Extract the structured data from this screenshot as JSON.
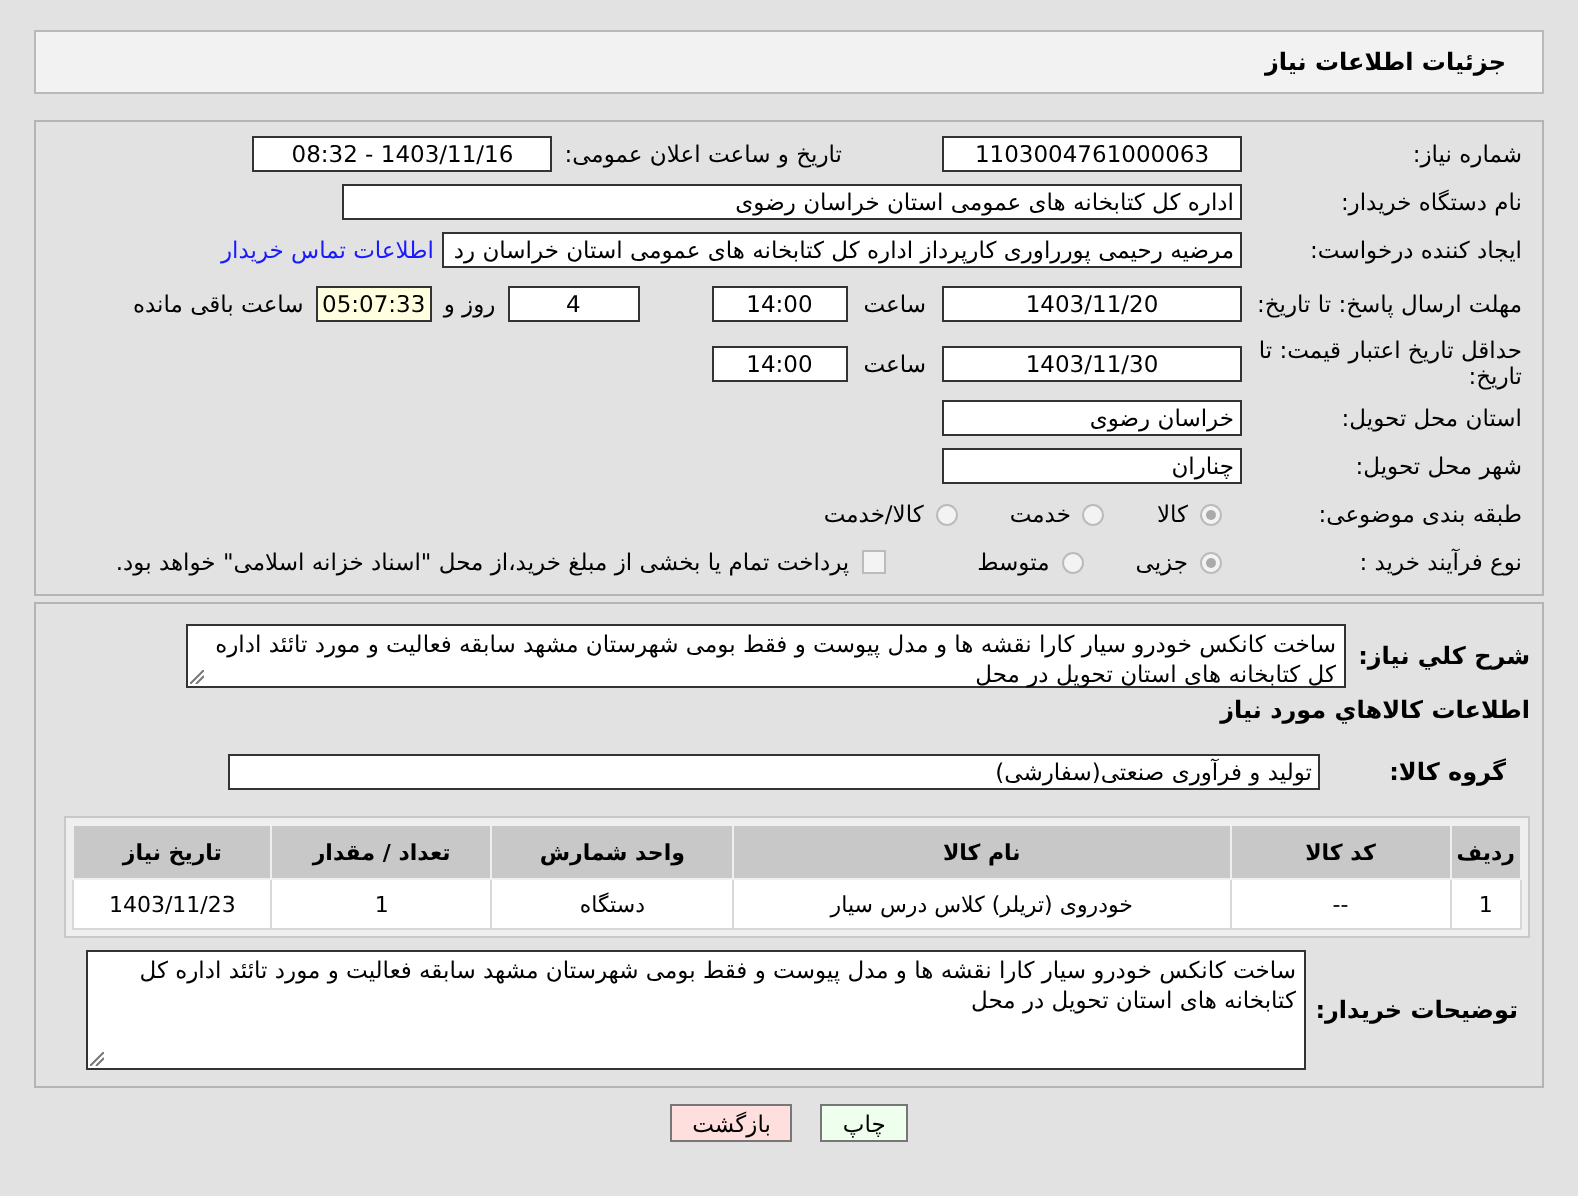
{
  "header": {
    "title": "جزئیات اطلاعات نیاز"
  },
  "need_number": {
    "label": "شماره نیاز:",
    "value": "1103004761000063"
  },
  "announce": {
    "label": "تاریخ و ساعت اعلان عمومی:",
    "value": "1403/11/16 - 08:32"
  },
  "buyer_org": {
    "label": "نام دستگاه خریدار:",
    "value": "اداره کل کتابخانه های عمومی استان خراسان رضوی"
  },
  "requester": {
    "label": "ایجاد کننده درخواست:",
    "value": "مرضیه رحیمی پورراوری کارپرداز اداره کل کتابخانه های عمومی استان خراسان رد",
    "link": "اطلاعات تماس خریدار"
  },
  "reply_deadline": {
    "label": "مهلت ارسال پاسخ: تا تاریخ:",
    "date": "1403/11/20",
    "time_label": "ساعت",
    "time": "14:00",
    "days": "4",
    "days_label": "روز و",
    "remaining": "05:07:33",
    "remaining_label": "ساعت باقی مانده"
  },
  "price_validity": {
    "label": "حداقل تاریخ اعتبار قیمت: تا تاریخ:",
    "date": "1403/11/30",
    "time_label": "ساعت",
    "time": "14:00"
  },
  "province": {
    "label": "استان محل تحویل:",
    "value": "خراسان رضوی"
  },
  "city": {
    "label": "شهر محل تحویل:",
    "value": "چناران"
  },
  "category": {
    "label": "طبقه بندی موضوعی:",
    "options": [
      {
        "label": "کالا",
        "selected": true
      },
      {
        "label": "خدمت",
        "selected": false
      },
      {
        "label": "کالا/خدمت",
        "selected": false
      }
    ]
  },
  "process": {
    "label": "نوع فرآیند خرید :",
    "options": [
      {
        "label": "جزیی",
        "selected": true
      },
      {
        "label": "متوسط",
        "selected": false
      }
    ],
    "treasury": {
      "checked": false,
      "label": "پرداخت تمام یا بخشی از مبلغ خرید،از محل \"اسناد خزانه اسلامی\" خواهد بود."
    }
  },
  "summary": {
    "label": "شرح کلي نياز:",
    "value": "ساخت کانکس خودرو سیار کارا نقشه ها و مدل پیوست و فقط بومی شهرستان مشهد سابقه فعالیت و مورد تائئد اداره کل کتابخانه های استان تحویل در محل"
  },
  "goods_title": "اطلاعات کالاهاي مورد نياز",
  "goods_group": {
    "label": "گروه کالا:",
    "value": "تولید و فرآوری صنعتی(سفارشی)"
  },
  "table": {
    "columns": [
      "ردیف",
      "کد کالا",
      "نام کالا",
      "واحد شمارش",
      "تعداد / مقدار",
      "تاریخ نیاز"
    ],
    "rows": [
      [
        "1",
        "--",
        "خودروی (تریلر) کلاس درس سیار",
        "دستگاه",
        "1",
        "1403/11/23"
      ]
    ]
  },
  "buyer_notes": {
    "label": "توضیحات خریدار:",
    "value": "ساخت کانکس خودرو سیار کارا نقشه ها و مدل پیوست و فقط بومی شهرستان مشهد سابقه فعالیت و مورد تائئد اداره کل کتابخانه های استان تحویل در محل"
  },
  "buttons": [
    {
      "label": "چاپ",
      "kind": "print"
    },
    {
      "label": "بازگشت",
      "kind": "back"
    }
  ]
}
